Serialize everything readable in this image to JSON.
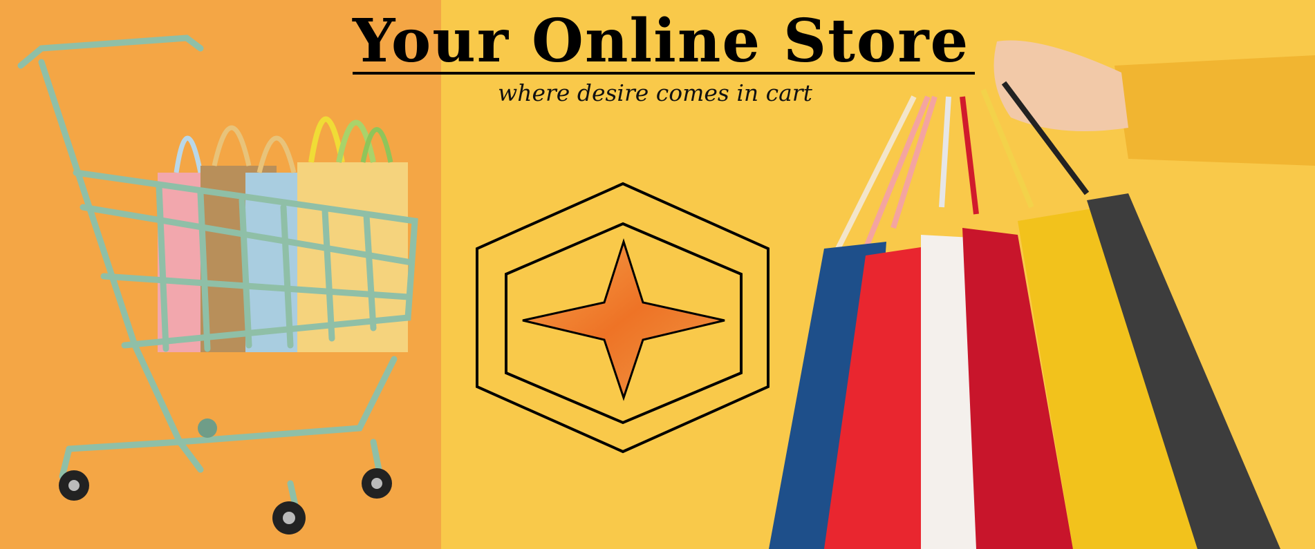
{
  "banner": {
    "title": "Your Online Store",
    "tagline": "where desire comes in cart"
  },
  "colors": {
    "left_bg": "#f4a645",
    "main_bg": "#f9c94a",
    "cart": "#8fbfa7",
    "star": "#ef7d2a",
    "sleeve": "#f1b531"
  },
  "icons": [
    "shopping-cart-illustration",
    "logo-emblem",
    "shopping-bags-illustration"
  ]
}
